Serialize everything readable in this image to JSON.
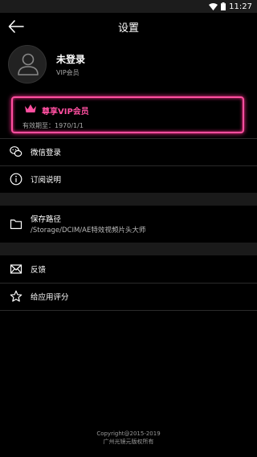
{
  "status_bar": {
    "time": "11:27"
  },
  "header": {
    "title": "设置"
  },
  "profile": {
    "name": "未登录",
    "subtitle": "VIP会员"
  },
  "vip_card": {
    "title": "尊享VIP会员",
    "expiry": "有效期至：1970/1/1"
  },
  "menu": {
    "wechat_login": "微信登录",
    "subscription_info": "订阅说明",
    "save_path_label": "保存路径",
    "save_path_value": "/Storage/DCIM/AE特效视频片头大师",
    "feedback": "反馈",
    "rate_app": "给应用评分"
  },
  "footer": {
    "line1": "Copyright@2015-2019",
    "line2": "广州光镜元版权所有"
  },
  "colors": {
    "accent": "#ff4fa0",
    "background": "#000000",
    "section_gap": "#1a1a1a"
  }
}
